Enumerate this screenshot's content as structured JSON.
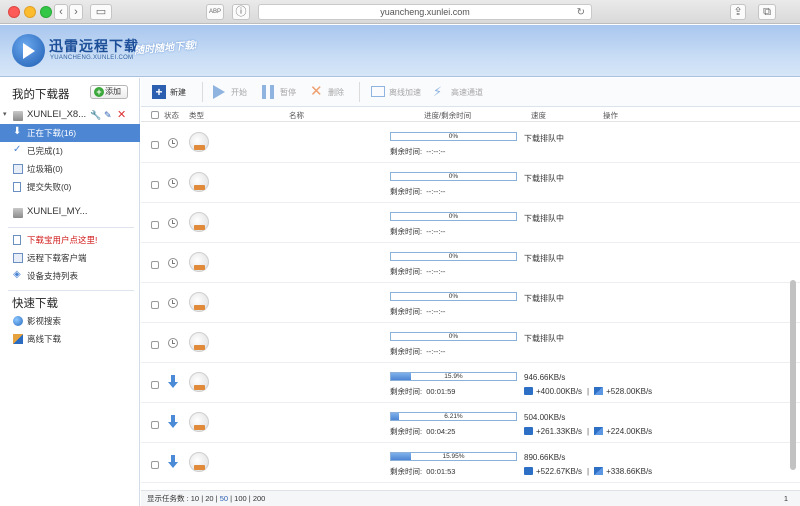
{
  "browser": {
    "url": "yuancheng.xunlei.com",
    "abp_label": "ABP"
  },
  "brand": {
    "title": "迅雷远程下载",
    "subtitle": "YUANCHENG.XUNLEI.COM",
    "slogan": "随时随地下载!"
  },
  "sidebar": {
    "heading": "我的下载器",
    "add_label": "添加",
    "device1": "XUNLEI_X8...",
    "items": [
      {
        "label": "正在下载(16)",
        "icon": "download-arrow-icon"
      },
      {
        "label": "已完成(1)",
        "icon": "check-icon"
      },
      {
        "label": "垃圾箱(0)",
        "icon": "trash-icon"
      },
      {
        "label": "提交失败(0)",
        "icon": "document-icon"
      }
    ],
    "device2": "XUNLEI_MY...",
    "links": [
      {
        "label": "下载宝用户点这里!",
        "icon": "document-icon"
      },
      {
        "label": "远程下载客户端",
        "icon": "device-icon"
      },
      {
        "label": "设备支持列表",
        "icon": "layers-icon"
      }
    ],
    "quick_heading": "快速下载",
    "quick": [
      {
        "label": "影视搜索",
        "icon": "globe-icon"
      },
      {
        "label": "离线下载",
        "icon": "offline-icon"
      }
    ]
  },
  "toolbar": {
    "new": "新建",
    "start": "开始",
    "pause": "暂停",
    "delete": "删除",
    "offline": "离线加速",
    "highspeed": "高速通道"
  },
  "table": {
    "headers": {
      "status": "状态",
      "type": "类型",
      "name": "名称",
      "progress": "进度/剩余时间",
      "speed": "速度",
      "action": "操作"
    },
    "rows": [
      {
        "status": "waiting",
        "progress": 0,
        "progress_text": "0%",
        "remain_label": "剩余时间:",
        "remain": "--:--:--",
        "speed": "下载排队中"
      },
      {
        "status": "waiting",
        "progress": 0,
        "progress_text": "0%",
        "remain_label": "剩余时间:",
        "remain": "--:--:--",
        "speed": "下载排队中"
      },
      {
        "status": "waiting",
        "progress": 0,
        "progress_text": "0%",
        "remain_label": "剩余时间:",
        "remain": "--:--:--",
        "speed": "下载排队中"
      },
      {
        "status": "waiting",
        "progress": 0,
        "progress_text": "0%",
        "remain_label": "剩余时间:",
        "remain": "--:--:--",
        "speed": "下载排队中"
      },
      {
        "status": "waiting",
        "progress": 0,
        "progress_text": "0%",
        "remain_label": "剩余时间:",
        "remain": "--:--:--",
        "speed": "下载排队中"
      },
      {
        "status": "waiting",
        "progress": 0,
        "progress_text": "0%",
        "remain_label": "剩余时间:",
        "remain": "--:--:--",
        "speed": "下载排队中"
      },
      {
        "status": "downloading",
        "progress": 15.9,
        "progress_text": "15.9%",
        "remain_label": "剩余时间:",
        "remain": "00:01:59",
        "speed": "946.66KB/s",
        "accel1": "+400.00KB/s",
        "accel2": "+528.00KB/s"
      },
      {
        "status": "downloading",
        "progress": 6.21,
        "progress_text": "6.21%",
        "remain_label": "剩余时间:",
        "remain": "00:04:25",
        "speed": "504.00KB/s",
        "accel1": "+261.33KB/s",
        "accel2": "+224.00KB/s"
      },
      {
        "status": "downloading",
        "progress": 15.95,
        "progress_text": "15.95%",
        "remain_label": "剩余时间:",
        "remain": "00:01:53",
        "speed": "890.66KB/s",
        "accel1": "+522.67KB/s",
        "accel2": "+338.66KB/s"
      }
    ]
  },
  "footer": {
    "label": "显示任务数 :",
    "sizes": [
      "10",
      "20",
      "50",
      "100",
      "200"
    ],
    "current": "50",
    "page": "1"
  }
}
